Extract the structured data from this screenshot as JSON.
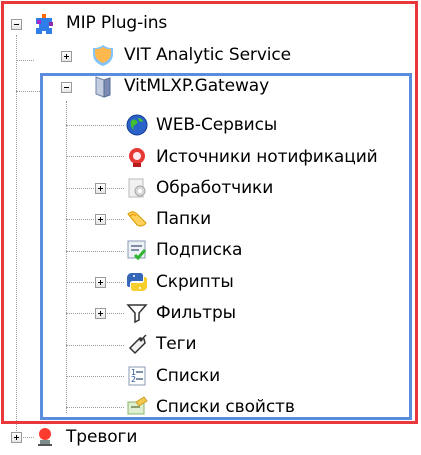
{
  "tree": {
    "root": {
      "label": "MIP Plug-ins",
      "icon": "puzzle-icon"
    },
    "items": [
      {
        "label": "VIT Analytic Service",
        "icon": "shield-icon"
      },
      {
        "label": "VitMLXP.Gateway",
        "icon": "gateway-icon"
      },
      {
        "label": "WEB-Сервисы",
        "icon": "globe-icon"
      },
      {
        "label": "Источники нотификаций",
        "icon": "notification-source-icon"
      },
      {
        "label": "Обработчики",
        "icon": "handler-icon"
      },
      {
        "label": "Папки",
        "icon": "folder-icon"
      },
      {
        "label": "Подписка",
        "icon": "subscription-icon"
      },
      {
        "label": "Скрипты",
        "icon": "python-icon"
      },
      {
        "label": "Фильтры",
        "icon": "filter-icon"
      },
      {
        "label": "Теги",
        "icon": "tag-icon"
      },
      {
        "label": "Списки",
        "icon": "list-icon"
      },
      {
        "label": "Списки свойств",
        "icon": "property-list-icon"
      },
      {
        "label": "Тревоги",
        "icon": "alarm-icon"
      }
    ]
  }
}
